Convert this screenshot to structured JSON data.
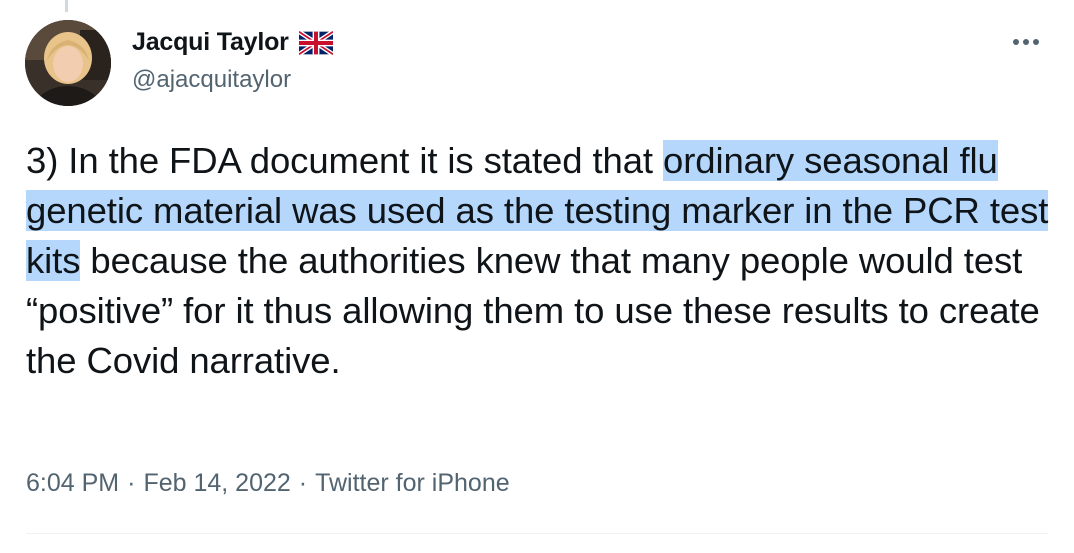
{
  "author": {
    "display_name": "Jacqui Taylor",
    "flag_icon": "uk-flag-icon",
    "handle": "@ajacquitaylor",
    "avatar_icon": "profile-photo"
  },
  "menu": {
    "more_icon": "more-options-icon"
  },
  "tweet": {
    "text_part1": "3) In the FDA document it is stated that ",
    "text_highlighted": "ordinary seasonal flu genetic material was used as the testing marker in the PCR test kits",
    "text_part2": " because the authorities knew that many people would test “positive” for it thus allowing them to use these results to create the Covid narrative."
  },
  "meta": {
    "time": "6:04 PM",
    "date": "Feb 14, 2022",
    "source": "Twitter for iPhone",
    "separator": "·"
  },
  "colors": {
    "text": "#0f1419",
    "secondary": "#536471",
    "highlight": "#b5d7fc"
  }
}
